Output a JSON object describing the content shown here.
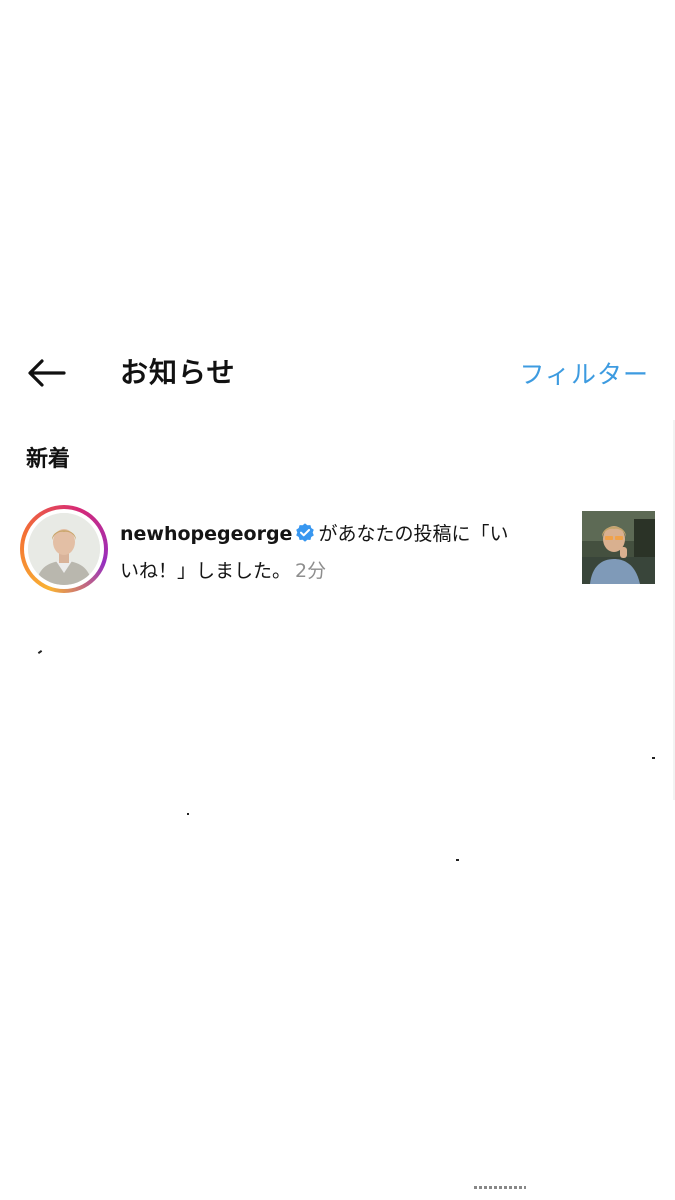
{
  "header": {
    "title": "お知らせ",
    "filter_label": "フィルター",
    "back_icon": "arrow-left-icon"
  },
  "section": {
    "heading": "新着"
  },
  "notification": {
    "username": "newhopegeorge",
    "verified_icon": "verified-badge-icon",
    "message": "があなたの投稿に「いいね！」しました。",
    "time": "2分"
  },
  "colors": {
    "accent": "#3d9be0",
    "verified": "#3897f0",
    "timestamp": "#8e8e8e",
    "text": "#111111",
    "background": "#ffffff"
  }
}
